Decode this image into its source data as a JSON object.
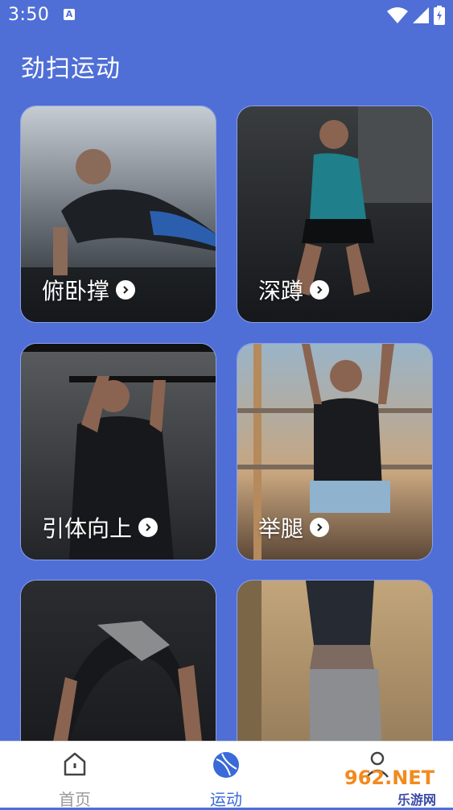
{
  "status_bar": {
    "time": "3:50",
    "notification_glyph": "A"
  },
  "page": {
    "title": "劲扫运动"
  },
  "workouts": [
    {
      "label": "俯卧撑"
    },
    {
      "label": "深蹲"
    },
    {
      "label": "引体向上"
    },
    {
      "label": "举腿"
    },
    {
      "label": ""
    },
    {
      "label": ""
    }
  ],
  "nav": {
    "home_label": "首页",
    "sport_label": "运动",
    "profile_label": ""
  },
  "watermark": {
    "brand": "962.NET",
    "sub": "乐游网"
  },
  "colors": {
    "background": "#4f6fd6",
    "accent": "#3a6ad8",
    "nav_inactive": "#999999"
  },
  "icons": [
    "wifi-icon",
    "signal-icon",
    "battery-icon",
    "home-icon",
    "sport-ball-icon",
    "profile-icon",
    "chevron-right-icon"
  ]
}
